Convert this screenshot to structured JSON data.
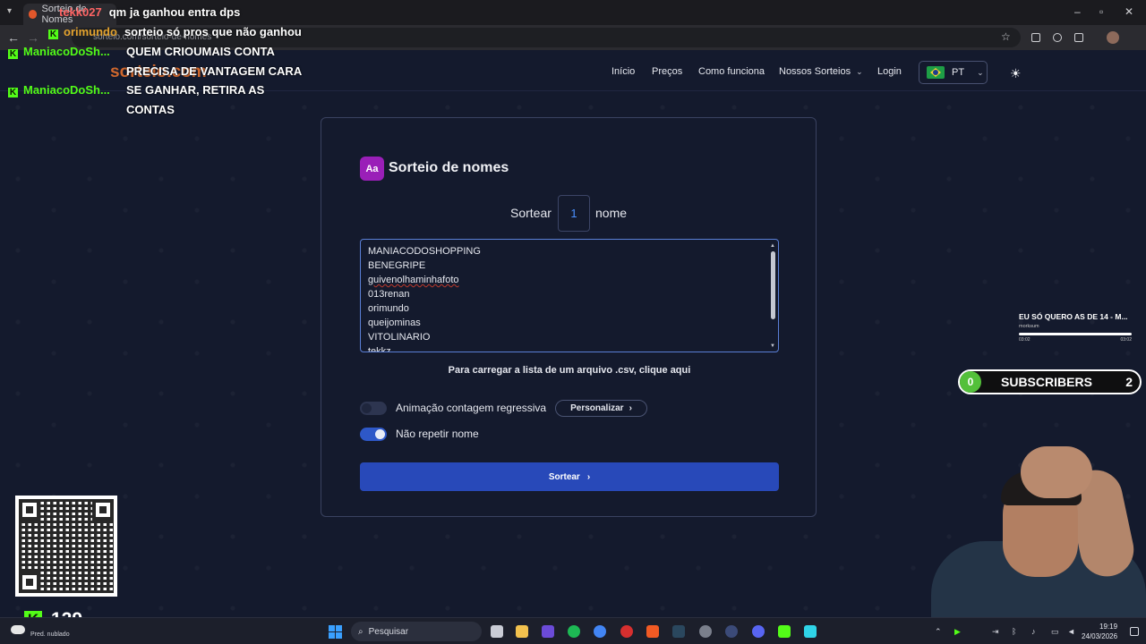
{
  "browser": {
    "tab_title": "Sorteio de Nomes",
    "url": "sorteio.com/sorteio-de-nomes"
  },
  "site": {
    "brand": "sorteio.com",
    "nav": [
      {
        "label": "Início"
      },
      {
        "label": "Preços"
      },
      {
        "label": "Como funciona"
      },
      {
        "label": "Nossos Sorteios"
      },
      {
        "label": "Login"
      }
    ],
    "language": "PT"
  },
  "card": {
    "icon_text": "Aa",
    "title": "Sorteio de nomes",
    "draw_prefix": "Sortear",
    "draw_count": "1",
    "draw_suffix": "nome",
    "names": [
      "MANIACODOSHOPPING",
      "BENEGRIPE",
      "guivenolhaminhafoto",
      "013renan",
      "orimundo",
      "queijominas",
      "VITOLINARIO",
      "tekkz"
    ],
    "csv_link": "Para carregar a lista de um arquivo .csv, clique aqui",
    "countdown_label": "Animação contagem regressiva",
    "countdown_on": false,
    "customize_label": "Personalizar",
    "no_repeat_label": "Não repetir nome",
    "no_repeat_on": true,
    "submit_label": "Sortear"
  },
  "chat": [
    {
      "user": "tekk027",
      "message": "qm ja ganhou entra dps"
    },
    {
      "user": "orimundo",
      "message": "sorteio só pros que não ganhou"
    },
    {
      "user": "ManiacoDoSh...",
      "message": "QUEM CRIOUMAIS CONTA PRECISA DE VANTAGEM CARA"
    },
    {
      "user": "ManiacoDoSh...",
      "message": "SE GANHAR, RETIRA AS CONTAS"
    }
  ],
  "now_playing": {
    "title": "EU SÓ QUERO AS DE 14 - M...",
    "artist": "morksum",
    "time_elapsed": "03:02",
    "time_total": "03:02",
    "progress": 1.0
  },
  "subscribers": {
    "count": "0",
    "label": "SUBSCRIBERS",
    "goal": "2"
  },
  "kick_viewers": "129",
  "taskbar": {
    "weather": "Pred. nublado",
    "search_placeholder": "Pesquisar",
    "time": "19:19",
    "date": "24/03/2026"
  },
  "colors": {
    "page_bg": "#141a2d",
    "accent_blue": "#2849b9",
    "icon_purple": "#9a1fb8",
    "kick_green": "#53fc18"
  }
}
